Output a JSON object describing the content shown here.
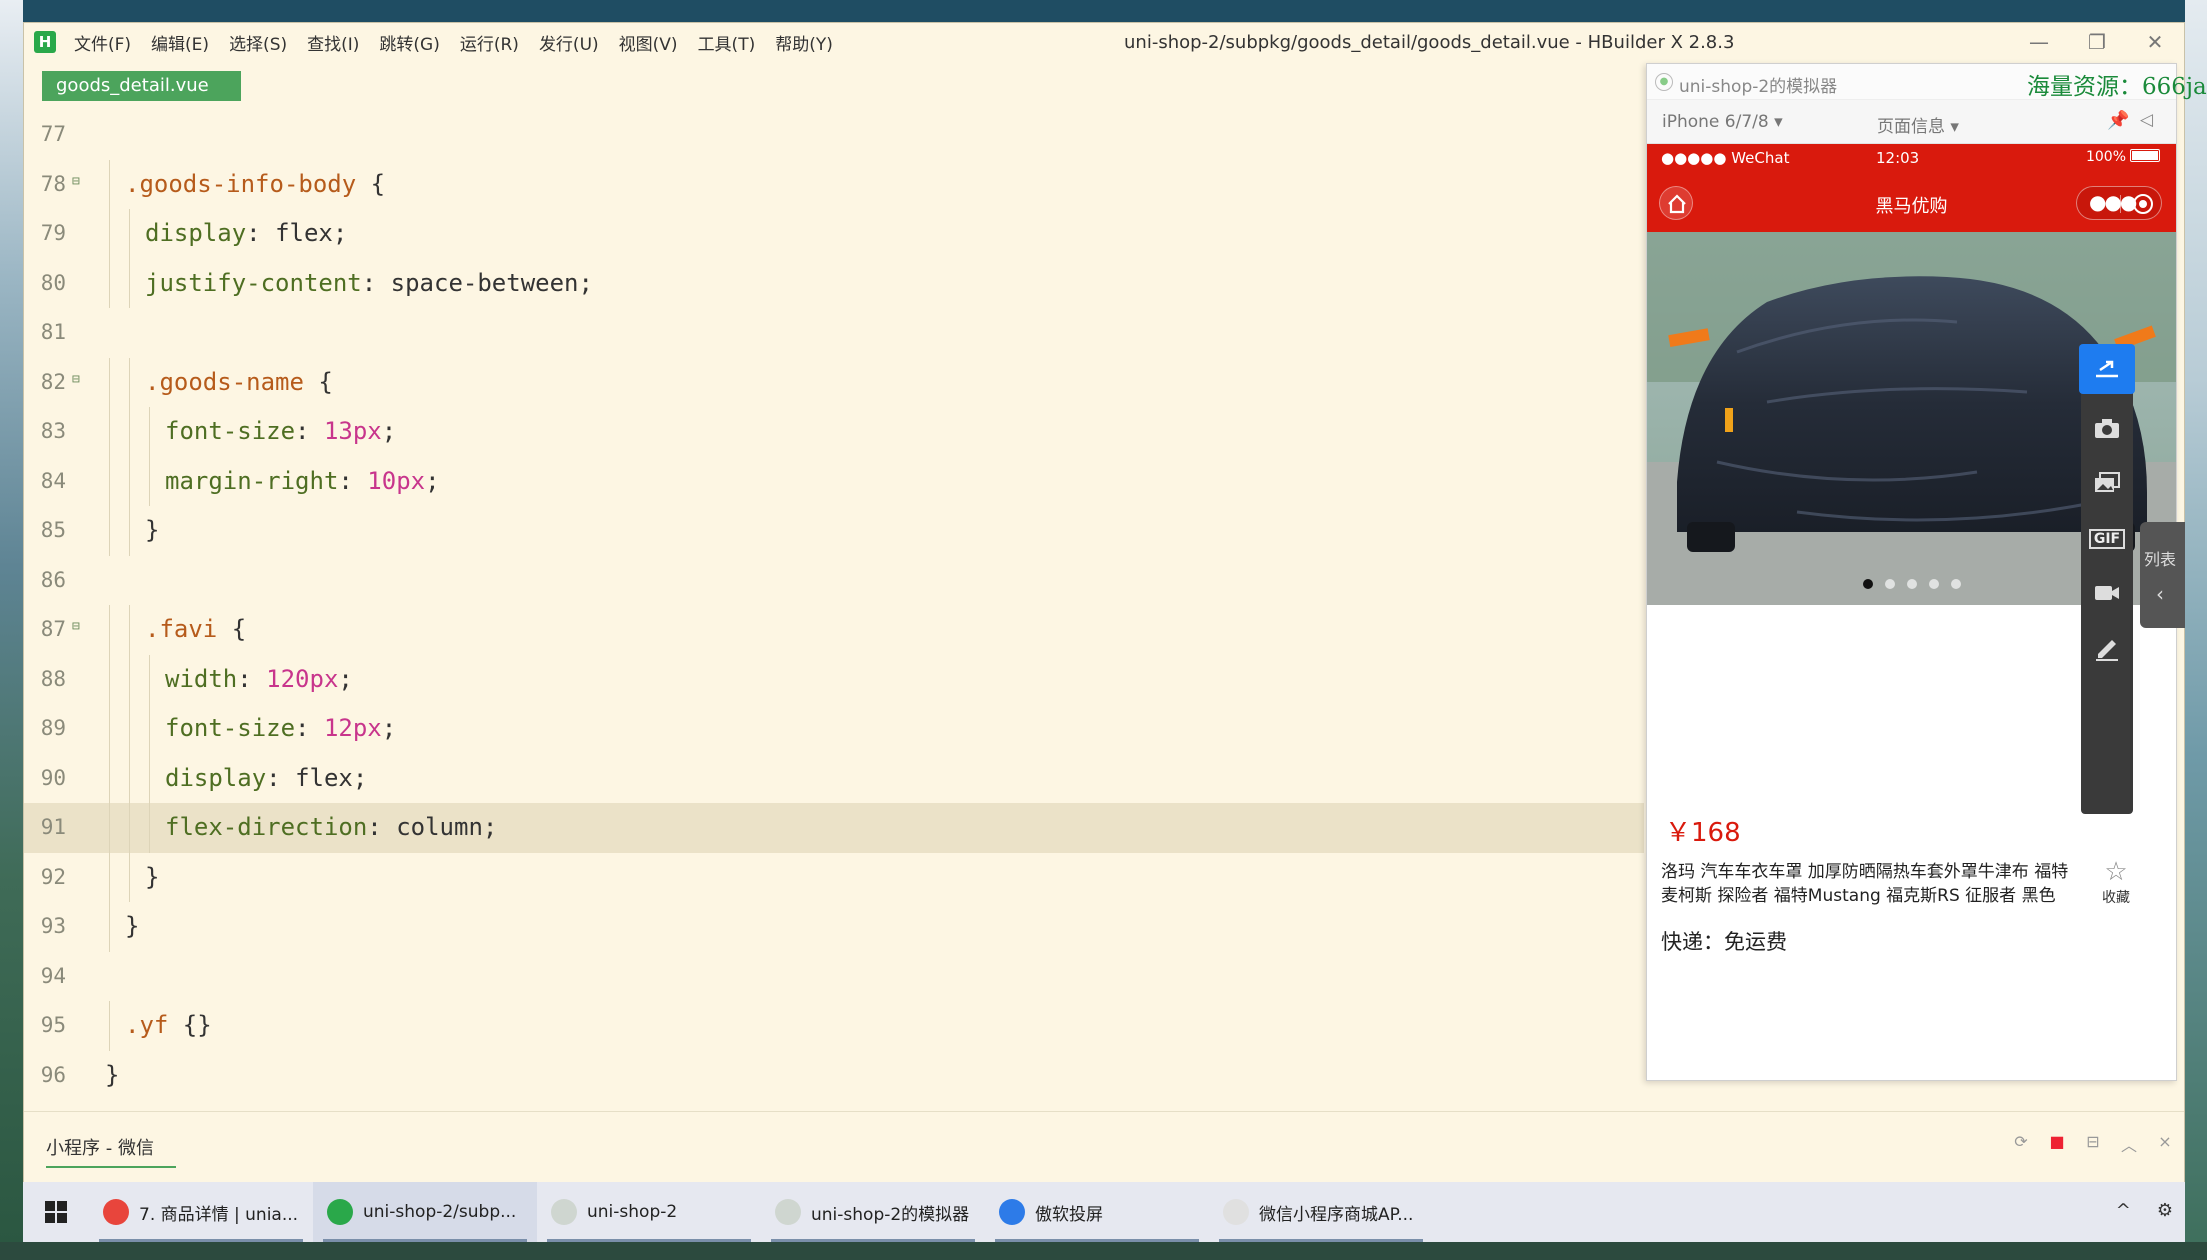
{
  "window": {
    "title": "uni-shop-2/subpkg/goods_detail/goods_detail.vue - HBuilder X 2.8.3",
    "logo": "H",
    "menu": [
      "文件(F)",
      "编辑(E)",
      "选择(S)",
      "查找(I)",
      "跳转(G)",
      "运行(R)",
      "发行(U)",
      "视图(V)",
      "工具(T)",
      "帮助(Y)"
    ],
    "controls": {
      "minimize": "—",
      "maximize": "❐",
      "close": "✕"
    }
  },
  "editor": {
    "tab": "goods_detail.vue",
    "highlighted_line": 91,
    "lines": [
      {
        "n": "77",
        "fold": false,
        "indent": 0,
        "tokens": []
      },
      {
        "n": "78",
        "fold": true,
        "indent": 1,
        "tokens": [
          {
            "t": ".goods-info-body",
            "c": "sel"
          },
          {
            "t": " {",
            "c": "punc"
          }
        ]
      },
      {
        "n": "79",
        "fold": false,
        "indent": 2,
        "tokens": [
          {
            "t": "display",
            "c": "prop"
          },
          {
            "t": ": ",
            "c": "punc"
          },
          {
            "t": "flex",
            "c": "val"
          },
          {
            "t": ";",
            "c": "punc"
          }
        ]
      },
      {
        "n": "80",
        "fold": false,
        "indent": 2,
        "tokens": [
          {
            "t": "justify-content",
            "c": "prop"
          },
          {
            "t": ": ",
            "c": "punc"
          },
          {
            "t": "space-between",
            "c": "val"
          },
          {
            "t": ";",
            "c": "punc"
          }
        ]
      },
      {
        "n": "81",
        "fold": false,
        "indent": 0,
        "tokens": []
      },
      {
        "n": "82",
        "fold": true,
        "indent": 2,
        "tokens": [
          {
            "t": ".goods-name",
            "c": "sel"
          },
          {
            "t": " {",
            "c": "punc"
          }
        ]
      },
      {
        "n": "83",
        "fold": false,
        "indent": 3,
        "tokens": [
          {
            "t": "font-size",
            "c": "prop"
          },
          {
            "t": ": ",
            "c": "punc"
          },
          {
            "t": "13px",
            "c": "num"
          },
          {
            "t": ";",
            "c": "punc"
          }
        ]
      },
      {
        "n": "84",
        "fold": false,
        "indent": 3,
        "tokens": [
          {
            "t": "margin-right",
            "c": "prop"
          },
          {
            "t": ": ",
            "c": "punc"
          },
          {
            "t": "10px",
            "c": "num"
          },
          {
            "t": ";",
            "c": "punc"
          }
        ]
      },
      {
        "n": "85",
        "fold": false,
        "indent": 2,
        "tokens": [
          {
            "t": "}",
            "c": "punc"
          }
        ]
      },
      {
        "n": "86",
        "fold": false,
        "indent": 0,
        "tokens": []
      },
      {
        "n": "87",
        "fold": true,
        "indent": 2,
        "tokens": [
          {
            "t": ".favi",
            "c": "sel"
          },
          {
            "t": " {",
            "c": "punc"
          }
        ]
      },
      {
        "n": "88",
        "fold": false,
        "indent": 3,
        "tokens": [
          {
            "t": "width",
            "c": "prop"
          },
          {
            "t": ": ",
            "c": "punc"
          },
          {
            "t": "120px",
            "c": "num"
          },
          {
            "t": ";",
            "c": "punc"
          }
        ]
      },
      {
        "n": "89",
        "fold": false,
        "indent": 3,
        "tokens": [
          {
            "t": "font-size",
            "c": "prop"
          },
          {
            "t": ": ",
            "c": "punc"
          },
          {
            "t": "12px",
            "c": "num"
          },
          {
            "t": ";",
            "c": "punc"
          }
        ]
      },
      {
        "n": "90",
        "fold": false,
        "indent": 3,
        "tokens": [
          {
            "t": "display",
            "c": "prop"
          },
          {
            "t": ": ",
            "c": "punc"
          },
          {
            "t": "flex",
            "c": "val"
          },
          {
            "t": ";",
            "c": "punc"
          }
        ]
      },
      {
        "n": "91",
        "fold": false,
        "indent": 3,
        "tokens": [
          {
            "t": "flex-direction",
            "c": "prop"
          },
          {
            "t": ": ",
            "c": "punc"
          },
          {
            "t": "column",
            "c": "val"
          },
          {
            "t": ";",
            "c": "punc"
          }
        ]
      },
      {
        "n": "92",
        "fold": false,
        "indent": 2,
        "tokens": [
          {
            "t": "}",
            "c": "punc"
          }
        ]
      },
      {
        "n": "93",
        "fold": false,
        "indent": 1,
        "tokens": [
          {
            "t": "}",
            "c": "punc"
          }
        ]
      },
      {
        "n": "94",
        "fold": false,
        "indent": 0,
        "tokens": []
      },
      {
        "n": "95",
        "fold": false,
        "indent": 1,
        "tokens": [
          {
            "t": ".yf",
            "c": "sel"
          },
          {
            "t": " {}",
            "c": "punc"
          }
        ]
      },
      {
        "n": "96",
        "fold": false,
        "indent": 0,
        "tokens": [
          {
            "t": "}",
            "c": "punc"
          }
        ]
      }
    ]
  },
  "console": {
    "tab": "小程序 - 微信"
  },
  "simulator": {
    "title": "uni-shop-2的模拟器",
    "watermark": "海量资源：666ja",
    "device": "iPhone 6/7/8 ▾",
    "page_info": "页面信息 ▾",
    "status": {
      "carrier": "●●●●● WeChat",
      "time": "12:03",
      "battery": "100%"
    },
    "nav_title": "黑马优购",
    "swiper": {
      "count": 5,
      "active": 0
    },
    "tools": [
      "share-icon",
      "camera-icon",
      "image-icon",
      "gif-icon",
      "video-icon",
      "edit-icon"
    ],
    "gif_label": "GIF",
    "price": "￥168",
    "goods_name": "洛玛 汽车车衣车罩 加厚防晒隔热车套外罩牛津布 福特麦柯斯 探险者 福特Mustang 福克斯RS 征服者 黑色",
    "favi_label": "收藏",
    "shipping": "快递：免运费"
  },
  "side_list": {
    "label": "列表",
    "chevron": "‹"
  },
  "taskbar": {
    "items": [
      {
        "label": "7. 商品详情 | unia...",
        "icon": "chrome-icon",
        "color": "#e8453c"
      },
      {
        "label": "uni-shop-2/subp...",
        "icon": "hbuilder-icon",
        "color": "#2aa84a"
      },
      {
        "label": "uni-shop-2",
        "icon": "wechat-devtools-icon",
        "color": "#cfd6d0"
      },
      {
        "label": "uni-shop-2的模拟器",
        "icon": "simulator-icon",
        "color": "#cfd6d0"
      },
      {
        "label": "傲软投屏",
        "icon": "apowermirror-icon",
        "color": "#2d7be8"
      },
      {
        "label": "微信小程序商城AP...",
        "icon": "typora-icon",
        "color": "#e0e0e0"
      }
    ],
    "active_index": 1,
    "tray": [
      "^",
      "⚙"
    ]
  }
}
